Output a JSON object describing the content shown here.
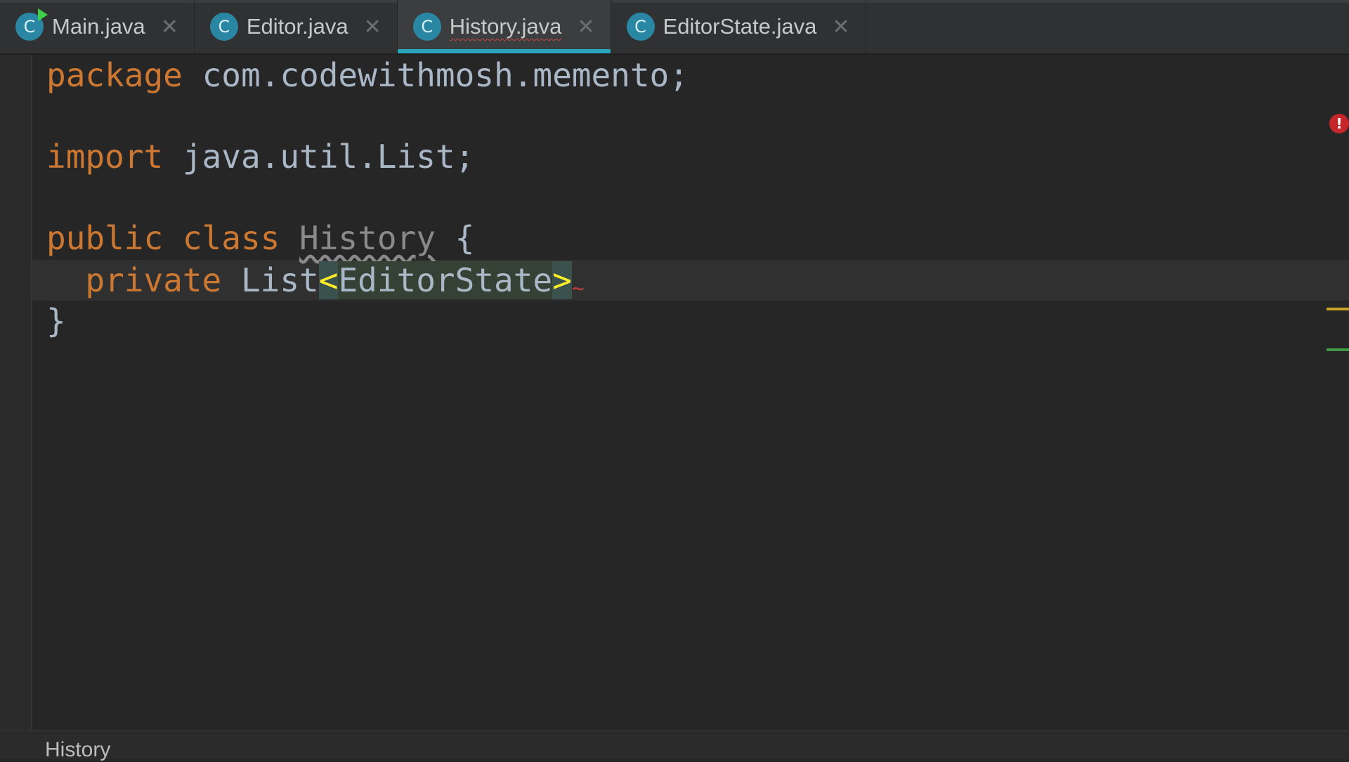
{
  "tabs": [
    {
      "label": "Main.java",
      "icon": "class-icon",
      "icon_glyph": "C",
      "runnable": true,
      "active": false
    },
    {
      "label": "Editor.java",
      "icon": "class-icon",
      "icon_glyph": "C",
      "runnable": false,
      "active": false
    },
    {
      "label": "History.java",
      "icon": "class-icon",
      "icon_glyph": "C",
      "runnable": false,
      "active": true
    },
    {
      "label": "EditorState.java",
      "icon": "class-icon",
      "icon_glyph": "C",
      "runnable": false,
      "active": false
    }
  ],
  "close_glyph": "✕",
  "code": {
    "line1": {
      "kw": "package",
      "rest": " com.codewithmosh.memento;"
    },
    "line2": {
      "kw": "import",
      "rest": " java.util.List;"
    },
    "line3": {
      "kw1": "public",
      "kw2": " class ",
      "cls": "History",
      "rest": " {"
    },
    "line4": {
      "indent": "  ",
      "kw": "private",
      "sp": " ",
      "type": "List",
      "lt": "<",
      "generic": "EditorState",
      "gt": ">",
      "err": "~"
    },
    "line5": {
      "text": "}"
    }
  },
  "markers": {
    "error_glyph": "!"
  },
  "breadcrumb": "History",
  "colors": {
    "keyword": "#cc7832",
    "text": "#a9b7c6",
    "bracket_match": "#ffef28",
    "active_tab_underline": "#2aa7bd",
    "error": "#c5262b"
  }
}
